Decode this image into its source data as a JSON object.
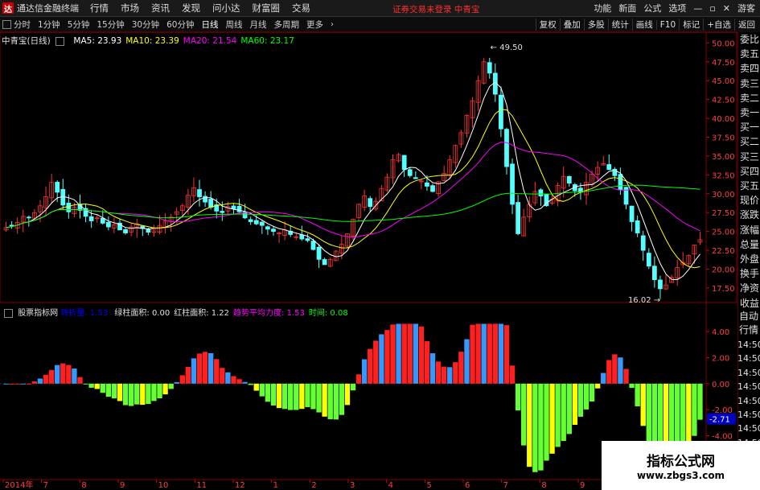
{
  "app": {
    "title": "通达信金融终端",
    "logo": "达"
  },
  "menu": [
    "行情",
    "市场",
    "资讯",
    "发现",
    "问小达",
    "财富圈",
    "交易"
  ],
  "warning": "证券交易未登录  中青宝",
  "topright": [
    "功能",
    "新面",
    "公式",
    "选项"
  ],
  "guest": "游客",
  "periods": [
    "分时",
    "1分钟",
    "5分钟",
    "15分钟",
    "30分钟",
    "60分钟",
    "日线",
    "周线",
    "月线",
    "多周期",
    "更多"
  ],
  "active_period": "日线",
  "tools": [
    "复权",
    "叠加",
    "多股",
    "统计",
    "画线",
    "F10",
    "标记",
    "+自选",
    "返回"
  ],
  "stock": {
    "name": "中青宝(日线)"
  },
  "ma": [
    {
      "label": "MA5: 23.93",
      "color": "#ffffff"
    },
    {
      "label": "MA10: 23.39",
      "color": "#ffff00"
    },
    {
      "label": "MA20: 21.54",
      "color": "#ff00ff"
    },
    {
      "label": "MA60: 23.17",
      "color": "#00ff00"
    }
  ],
  "price_axis": [
    "50.00",
    "47.50",
    "45.00",
    "42.50",
    "40.00",
    "37.50",
    "35.00",
    "32.50",
    "30.00",
    "27.50",
    "25.00",
    "22.50",
    "20.00",
    "17.50"
  ],
  "annotations": {
    "high": "49.50",
    "low": "16.02"
  },
  "indicator": {
    "name": "股票指标网",
    "items": [
      {
        "label": "绿柱面积: 0.00",
        "color": "#e0e0e0"
      },
      {
        "label": "红柱面积: 1.22",
        "color": "#e0e0e0"
      },
      {
        "label": "趋势平均力度: 1.53",
        "color": "#ff00ff"
      },
      {
        "label": "时间: 0.08",
        "color": "#00ff00"
      }
    ],
    "hidden_label": "转折量: 1.53",
    "axis": [
      "4.00",
      "2.00",
      "0.00",
      "-2.00",
      "-4.00",
      "-6.00"
    ],
    "current": "-2.71"
  },
  "sidebar": [
    "委比",
    "卖五",
    "卖四",
    "卖三",
    "卖二",
    "卖一",
    "买一",
    "买二",
    "买三",
    "买四",
    "买五",
    "现价",
    "涨跌",
    "涨幅",
    "总量",
    "外盘",
    "换手",
    "净资",
    "收益"
  ],
  "sidebar2": [
    "自动",
    "行情"
  ],
  "sidebar_times": [
    "14:50",
    "14:50",
    "14:50",
    "14:50",
    "14:50",
    "14:50",
    "14:50",
    "14:50",
    "14:50",
    "14:50"
  ],
  "xaxis": [
    "2014年",
    "7",
    "8",
    "9",
    "10",
    "11",
    "12",
    "1",
    "2",
    "3",
    "4",
    "5",
    "6",
    "7",
    "8",
    "9",
    "10",
    "11",
    "12"
  ],
  "watermark": {
    "line1": "指标公式网",
    "line2": "www.zbgs3.com"
  },
  "chart_data": {
    "type": "candlestick",
    "price_ylim": [
      16.0,
      51.0
    ],
    "close": [
      25.5,
      25.8,
      26.2,
      27.0,
      26.8,
      27.5,
      28.4,
      29.6,
      31.5,
      30.2,
      28.5,
      27.6,
      28.2,
      27.8,
      27.0,
      26.4,
      26.8,
      26.1,
      25.6,
      25.9,
      25.2,
      24.8,
      25.6,
      26.0,
      25.4,
      24.9,
      25.3,
      25.8,
      26.4,
      26.9,
      27.6,
      28.4,
      29.8,
      30.8,
      29.6,
      28.9,
      28.2,
      27.7,
      27.5,
      28.3,
      28.0,
      27.6,
      26.8,
      26.3,
      26.0,
      25.8,
      25.3,
      25.0,
      24.8,
      25.2,
      24.6,
      24.3,
      24.0,
      23.8,
      22.6,
      21.3,
      20.6,
      21.3,
      22.4,
      23.3,
      24.7,
      26.6,
      28.6,
      29.7,
      28.3,
      29.0,
      30.7,
      32.2,
      34.5,
      35.2,
      33.2,
      32.4,
      32.0,
      31.7,
      31.0,
      30.3,
      31.6,
      32.7,
      34.5,
      36.4,
      38.1,
      40.4,
      42.3,
      45.0,
      47.5,
      46.0,
      43.2,
      38.6,
      33.6,
      28.6,
      24.7,
      26.9,
      28.6,
      30.3,
      29.7,
      28.4,
      29.3,
      31.1,
      32.3,
      31.4,
      30.4,
      30.2,
      31.5,
      32.6,
      33.5,
      34.0,
      33.2,
      32.4,
      30.5,
      28.6,
      26.3,
      24.8,
      22.5,
      20.4,
      18.6,
      17.4,
      17.9,
      18.9,
      20.2,
      20.9,
      21.8,
      23.2,
      23.9
    ]
  }
}
